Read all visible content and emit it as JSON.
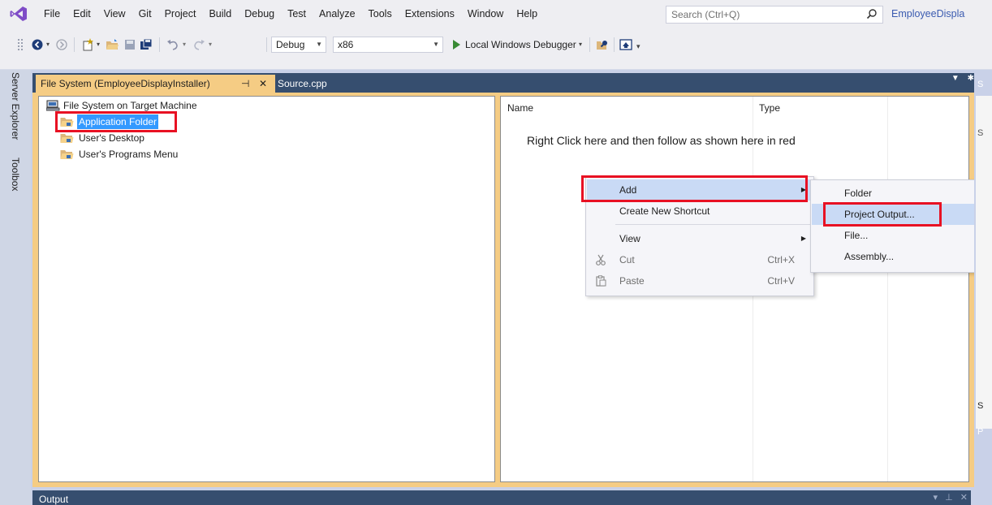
{
  "menubar": {
    "items": [
      "File",
      "Edit",
      "View",
      "Git",
      "Project",
      "Build",
      "Debug",
      "Test",
      "Analyze",
      "Tools",
      "Extensions",
      "Window",
      "Help"
    ],
    "search_placeholder": "Search (Ctrl+Q)",
    "solution_name": "EmployeeDispla"
  },
  "toolbar": {
    "config": "Debug",
    "platform": "x86",
    "debugger": "Local Windows Debugger"
  },
  "left_strip": {
    "tabs": [
      "Server Explorer",
      "Toolbox"
    ]
  },
  "doc_tabs": {
    "active": "File System (EmployeeDisplayInstaller)",
    "pin_glyph": "⊣",
    "close_glyph": "✕",
    "other": "Source.cpp"
  },
  "tree": {
    "root": "File System on Target Machine",
    "items": [
      "Application Folder",
      "User's Desktop",
      "User's Programs Menu"
    ]
  },
  "list": {
    "columns": [
      "Name",
      "Type"
    ],
    "instruction": "Right Click here and then follow as shown here in red"
  },
  "context_menu": {
    "items": [
      {
        "label": "Add",
        "shortcut": ""
      },
      {
        "label": "Create New Shortcut",
        "shortcut": ""
      },
      {
        "label": "View",
        "shortcut": ""
      },
      {
        "label": "Cut",
        "shortcut": "Ctrl+X"
      },
      {
        "label": "Paste",
        "shortcut": "Ctrl+V"
      }
    ]
  },
  "submenu": {
    "items": [
      "Folder",
      "Project Output...",
      "File...",
      "Assembly..."
    ]
  },
  "right_panel": {
    "letters": [
      "S",
      "S",
      "S",
      "P"
    ]
  },
  "output": {
    "title": "Output"
  },
  "colors": {
    "accent_tab": "#f5cc84",
    "tab_well": "#364e6f",
    "highlight_red": "#e81123",
    "selection": "#3399ff"
  }
}
